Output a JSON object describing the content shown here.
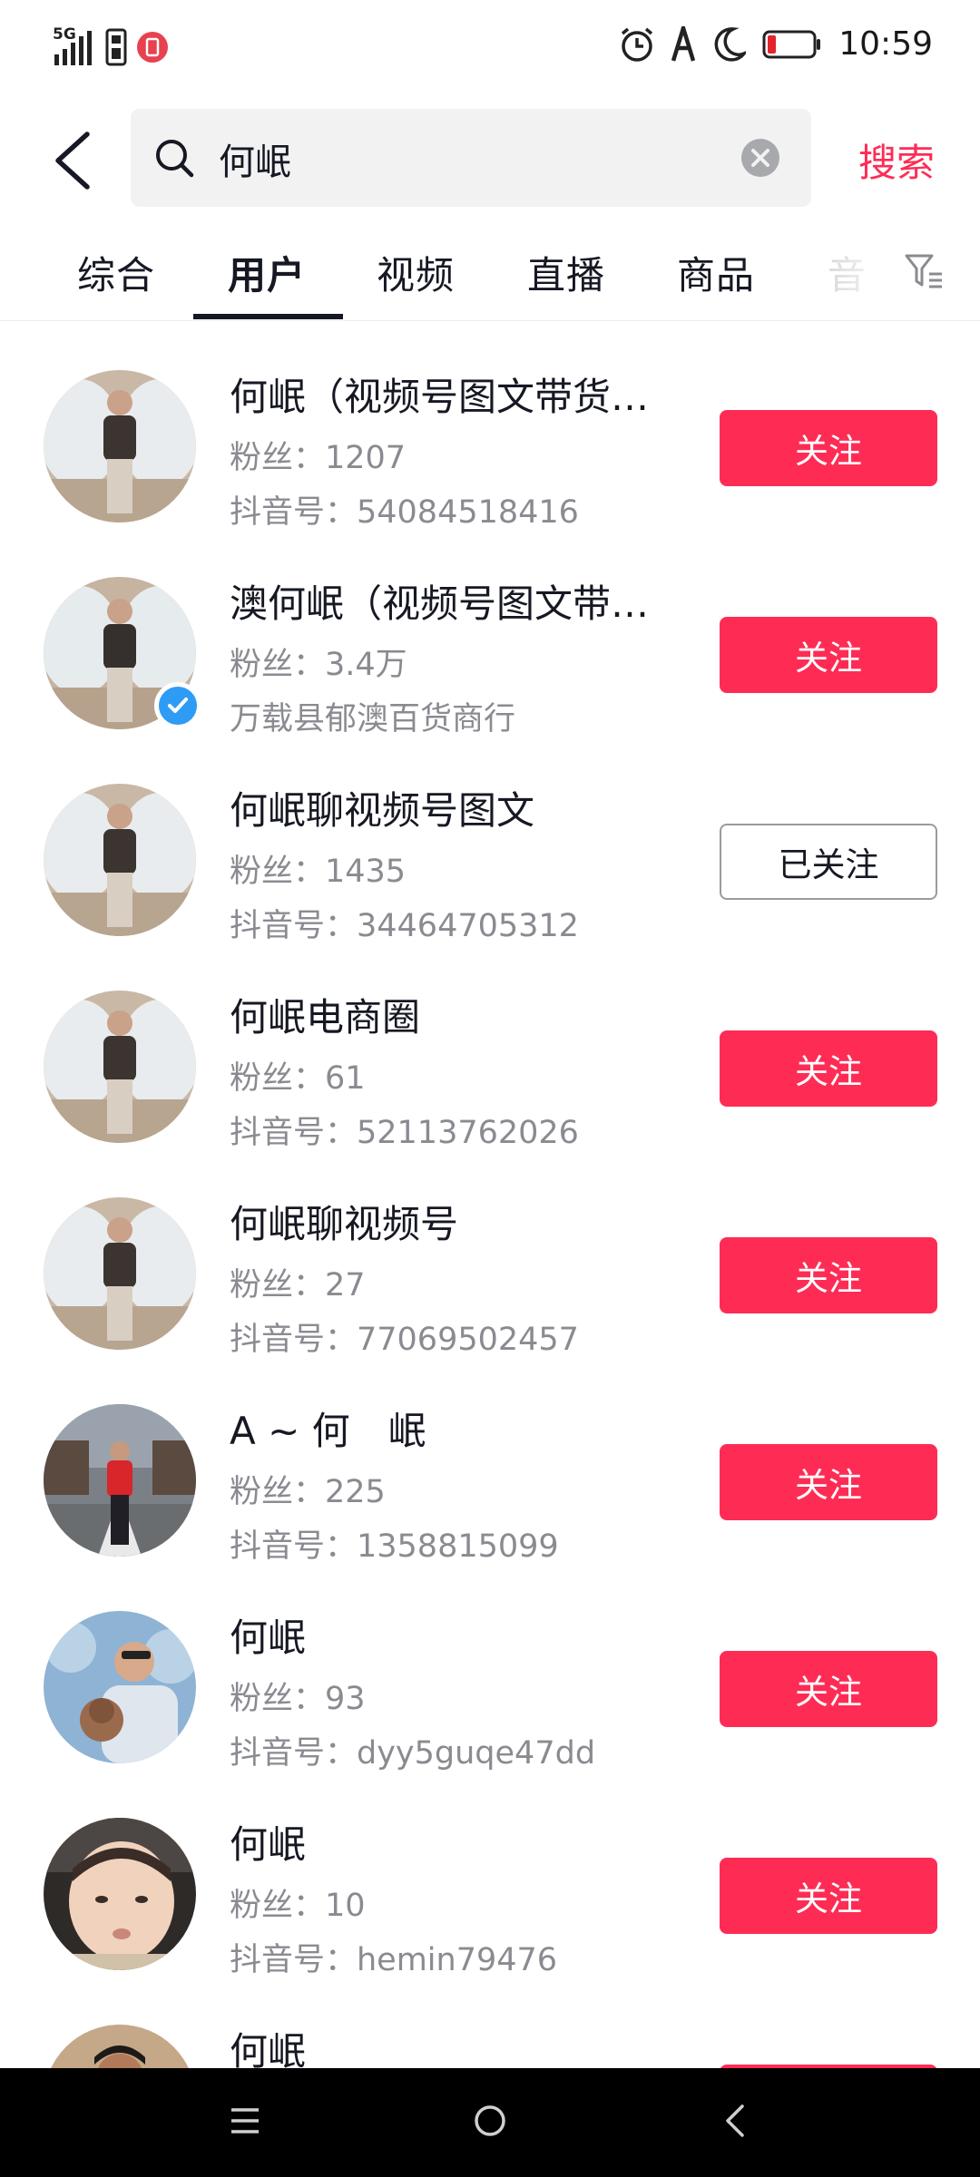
{
  "status_bar": {
    "network": "5G",
    "time": "10:59",
    "icons": [
      "signal-icon",
      "sim-icon",
      "notification-badge-icon",
      "alarm-icon",
      "a-icon",
      "moon-icon",
      "battery-icon"
    ]
  },
  "search": {
    "query": "何岷",
    "action_label": "搜索"
  },
  "tabs": [
    "综合",
    "用户",
    "视频",
    "直播",
    "商品",
    "音"
  ],
  "active_tab": "用户",
  "users": [
    {
      "name": "何岷（视频号图文带货…",
      "fans": "粉丝：1207",
      "id_line": "抖音号：54084518416",
      "follow_label": "关注",
      "followed": false,
      "verified": false
    },
    {
      "name": "澳何岷（视频号图文带…",
      "fans": "粉丝：3.4万",
      "id_line": "万载县郁澳百货商行",
      "follow_label": "关注",
      "followed": false,
      "verified": true
    },
    {
      "name": "何岷聊视频号图文",
      "fans": "粉丝：1435",
      "id_line": "抖音号：34464705312",
      "follow_label": "已关注",
      "followed": true,
      "verified": false
    },
    {
      "name": "何岷电商圈",
      "fans": "粉丝：61",
      "id_line": "抖音号：52113762026",
      "follow_label": "关注",
      "followed": false,
      "verified": false
    },
    {
      "name": "何岷聊视频号",
      "fans": "粉丝：27",
      "id_line": "抖音号：77069502457",
      "follow_label": "关注",
      "followed": false,
      "verified": false
    },
    {
      "name": "A ~ 何　岷",
      "fans": "粉丝：225",
      "id_line": "抖音号：1358815099",
      "follow_label": "关注",
      "followed": false,
      "verified": false
    },
    {
      "name": "何岷",
      "fans": "粉丝：93",
      "id_line": "抖音号：dyy5guqe47dd",
      "follow_label": "关注",
      "followed": false,
      "verified": false
    },
    {
      "name": "何岷",
      "fans": "粉丝：10",
      "id_line": "抖音号：hemin79476",
      "follow_label": "关注",
      "followed": false,
      "verified": false
    },
    {
      "name": "何岷",
      "fans": "",
      "id_line": "",
      "follow_label": "关注",
      "followed": false,
      "verified": false
    }
  ],
  "colors": {
    "accent": "#fe2c55",
    "text_primary": "#161823",
    "text_secondary": "#8a8b91",
    "verified_blue": "#2e9cf5"
  },
  "nav_bar": {
    "icons": [
      "menu-icon",
      "home-icon",
      "back-icon"
    ]
  }
}
